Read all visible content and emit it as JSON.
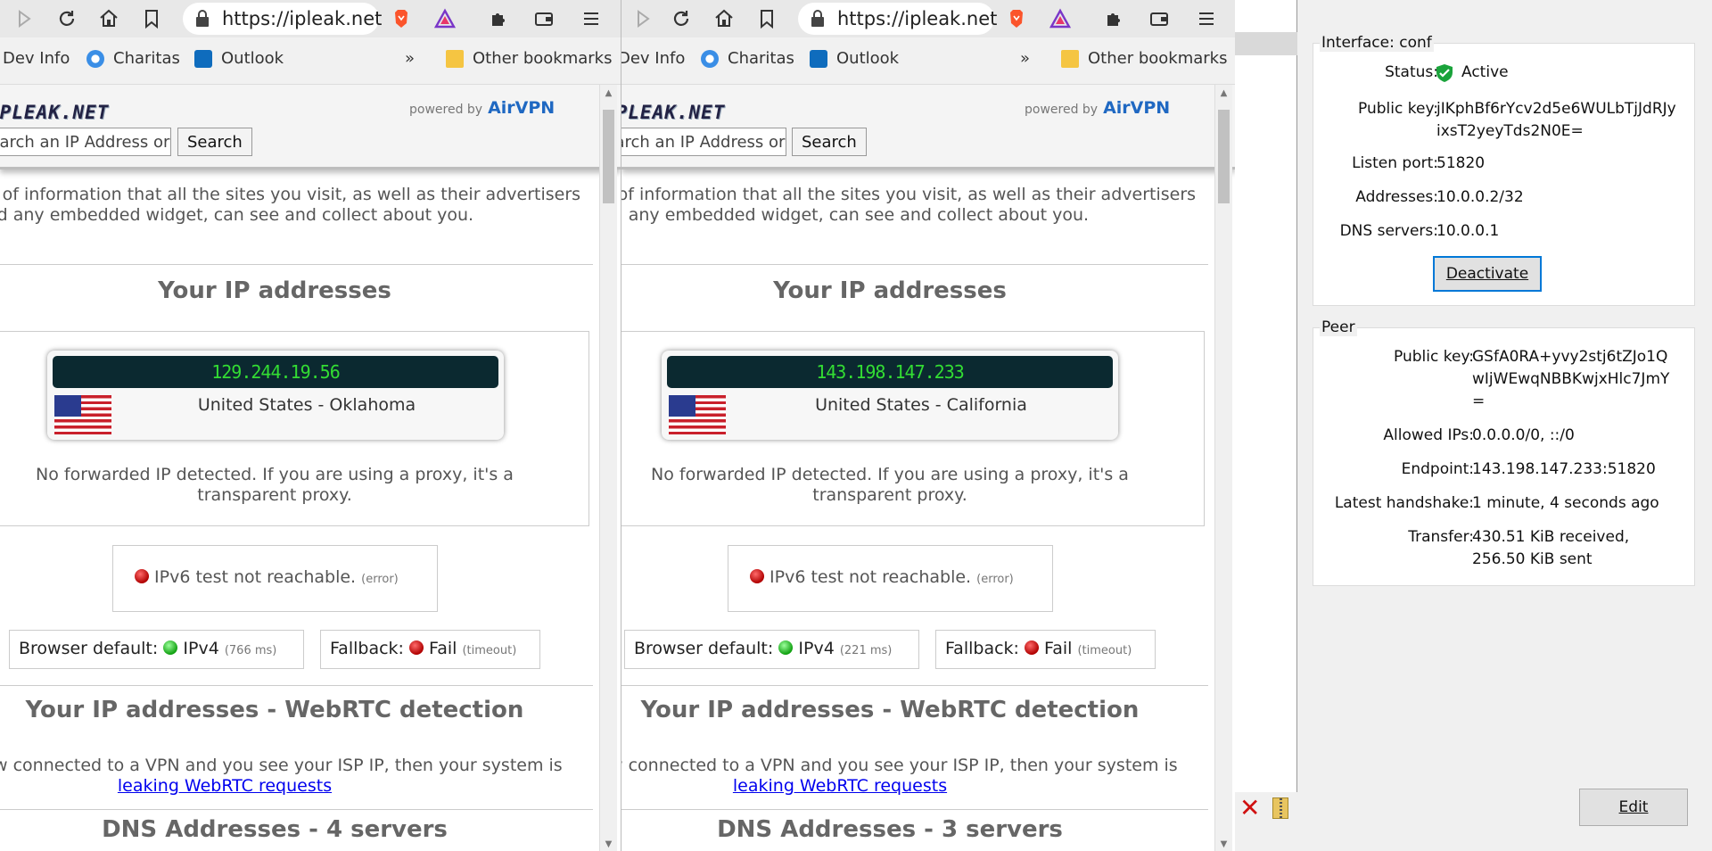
{
  "browser_left": {
    "url": "https://ipleak.net",
    "bookmarks": [
      "Dev Info",
      "Charitas",
      "Outlook"
    ],
    "other_bookmarks": "Other bookmarks",
    "overflow": "»",
    "site": {
      "logo": "IPLEAK.NET",
      "powered_by": "powered by",
      "airvpn": "AirVPN",
      "search_placeholder": "Search an IP Address or",
      "search_button": "Search",
      "intro": "This is the kind of information that all the sites you visit, as well as their advertisers and any embedded widget, can see and collect about you.",
      "ip_heading": "Your IP addresses",
      "ip": "129.244.19.56",
      "country": "United States - Oklahoma",
      "forwarded": "No forwarded IP detected. If you are using a proxy, it's a transparent proxy.",
      "ipv6_text": "IPv6 test not reachable.",
      "ipv6_note": "(error)",
      "browser_default_label": "Browser default:",
      "browser_default_value": "IPv4",
      "browser_default_ms": "(766 ms)",
      "fallback_label": "Fallback:",
      "fallback_value": "Fail",
      "fallback_note": "(timeout)",
      "webrtc_heading": "Your IP addresses - WebRTC detection",
      "webrtc_text": "If you are now connected to a VPN and you see your ISP IP, then your system is",
      "webrtc_link": "leaking WebRTC requests",
      "dns_heading": "DNS Addresses - 4 servers"
    }
  },
  "browser_right": {
    "url": "https://ipleak.net",
    "bookmarks": [
      "Dev Info",
      "Charitas",
      "Outlook"
    ],
    "other_bookmarks": "Other bookmarks",
    "overflow": "»",
    "site": {
      "logo": "IPLEAK.NET",
      "powered_by": "powered by",
      "airvpn": "AirVPN",
      "search_placeholder": "Search an IP Address or",
      "search_button": "Search",
      "intro": "This is the kind of information that all the sites you visit, as well as their advertisers and any embedded widget, can see and collect about you.",
      "ip_heading": "Your IP addresses",
      "ip": "143.198.147.233",
      "country": "United States - California",
      "forwarded": "No forwarded IP detected. If you are using a proxy, it's a transparent proxy.",
      "ipv6_text": "IPv6 test not reachable.",
      "ipv6_note": "(error)",
      "browser_default_label": "Browser default:",
      "browser_default_value": "IPv4",
      "browser_default_ms": "(221 ms)",
      "fallback_label": "Fallback:",
      "fallback_value": "Fail",
      "fallback_note": "(timeout)",
      "webrtc_heading": "Your IP addresses - WebRTC detection",
      "webrtc_text": "If you are now connected to a VPN and you see your ISP IP, then your system is",
      "webrtc_link": "leaking WebRTC requests",
      "dns_heading": "DNS Addresses - 3 servers"
    }
  },
  "wireguard": {
    "interface": {
      "title": "Interface: conf",
      "status_label": "Status:",
      "status_value": "Active",
      "pubkey_label": "Public key:",
      "pubkey_line1": "jIKphBf6rYcv2d5e6WULbTjJdRJy",
      "pubkey_line2": "ixsT2yeyTds2N0E=",
      "listen_label": "Listen port:",
      "listen_value": "51820",
      "addresses_label": "Addresses:",
      "addresses_value": "10.0.0.2/32",
      "dns_label": "DNS servers:",
      "dns_value": "10.0.0.1",
      "deactivate": "Deactivate"
    },
    "peer": {
      "title": "Peer",
      "pubkey_label": "Public key:",
      "pubkey_line1": "GSfA0RA+yvy2stj6tZJo1Q",
      "pubkey_line2": "wIjWEwqNBBKwjxHlc7JmY",
      "pubkey_line3": "=",
      "allowed_label": "Allowed IPs:",
      "allowed_value": "0.0.0.0/0, ::/0",
      "endpoint_label": "Endpoint:",
      "endpoint_value": "143.198.147.233:51820",
      "handshake_label": "Latest handshake:",
      "handshake_value": "1 minute, 4 seconds ago",
      "transfer_label": "Transfer:",
      "transfer_line1": "430.51 KiB received,",
      "transfer_line2": "256.50 KiB sent"
    },
    "edit": "Edit"
  },
  "colors": {
    "ip_text": "#33dd33",
    "ip_bar": "#0b2930",
    "active": "#1aa33b",
    "airvpn": "#1f68c2"
  }
}
